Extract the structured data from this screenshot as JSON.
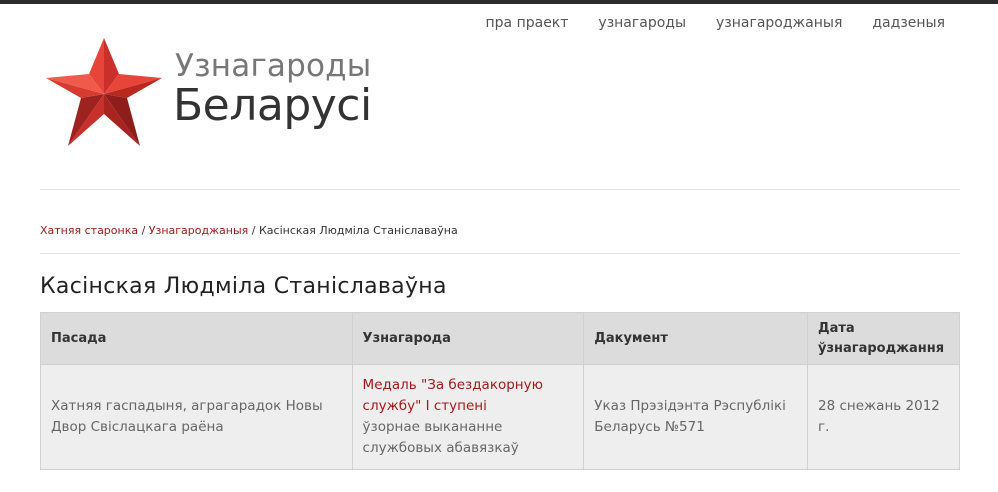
{
  "nav": {
    "items": [
      "пра праект",
      "узнагароды",
      "узнагароджаныя",
      "дадзеныя"
    ]
  },
  "logo": {
    "line1": "Узнагароды",
    "line2": "Беларусі",
    "icon": "red-star-icon",
    "colors": {
      "star_light": "#e8453a",
      "star_mid": "#c9302c",
      "star_dark": "#8e1d1b"
    }
  },
  "breadcrumb": {
    "home": "Хатняя старонка",
    "sep1": " / ",
    "section": "Узнагароджаныя",
    "sep2": " / ",
    "current": "Касінская Людміла Станіславаўна"
  },
  "page_title": "Касінская Людміла Станіславаўна",
  "table": {
    "headers": [
      "Пасада",
      "Узнагарода",
      "Дакумент",
      "Дата ўзнагароджання"
    ],
    "rows": [
      {
        "position": "Хатняя гаспадыня, аграгарадок Новы Двор Свіслацкага раёна",
        "award_name": "Медаль \"За бездакорную службу\" I ступені",
        "award_reason": "ўзорнае выкананне службовых абавязкаў",
        "document": "Указ Прэзідэнта Рэспублікі Беларусь №571",
        "date": "28 снежань 2012 г."
      }
    ]
  },
  "colors": {
    "accent": "#a31a1a",
    "header_bg": "#dcdcdc",
    "cell_bg": "#eeeeee",
    "topbar": "#2b2b2b"
  }
}
